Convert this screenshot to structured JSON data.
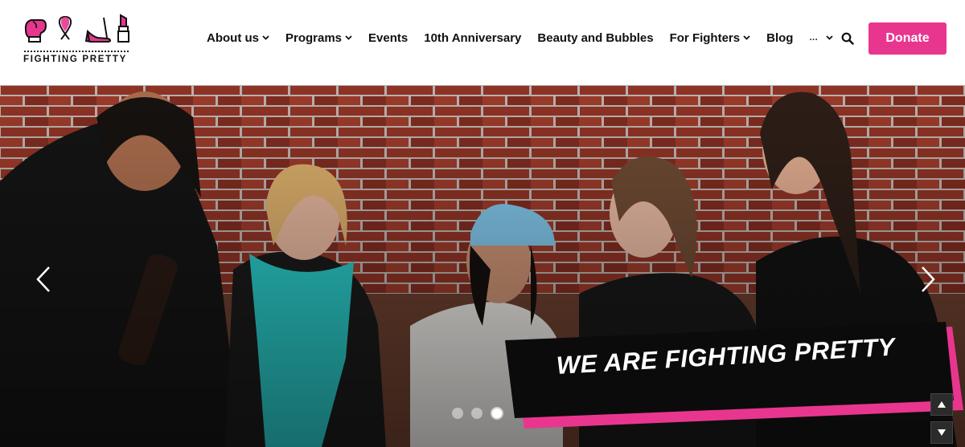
{
  "logo": {
    "text": "FIGHTING PRETTY"
  },
  "nav": {
    "items": [
      {
        "label": "About us",
        "has_dropdown": true
      },
      {
        "label": "Programs",
        "has_dropdown": true
      },
      {
        "label": "Events",
        "has_dropdown": false
      },
      {
        "label": "10th Anniversary",
        "has_dropdown": false
      },
      {
        "label": "Beauty and Bubbles",
        "has_dropdown": false
      },
      {
        "label": "For Fighters",
        "has_dropdown": true
      },
      {
        "label": "Blog",
        "has_dropdown": false
      }
    ],
    "more_label": "...",
    "search_icon": "search-icon"
  },
  "donate": {
    "label": "Donate"
  },
  "hero": {
    "title": "WE ARE FIGHTING PRETTY",
    "slides_count": 3,
    "active_slide": 3
  },
  "colors": {
    "brand_pink": "#e8368f",
    "banner_black": "#0b0b0b"
  }
}
